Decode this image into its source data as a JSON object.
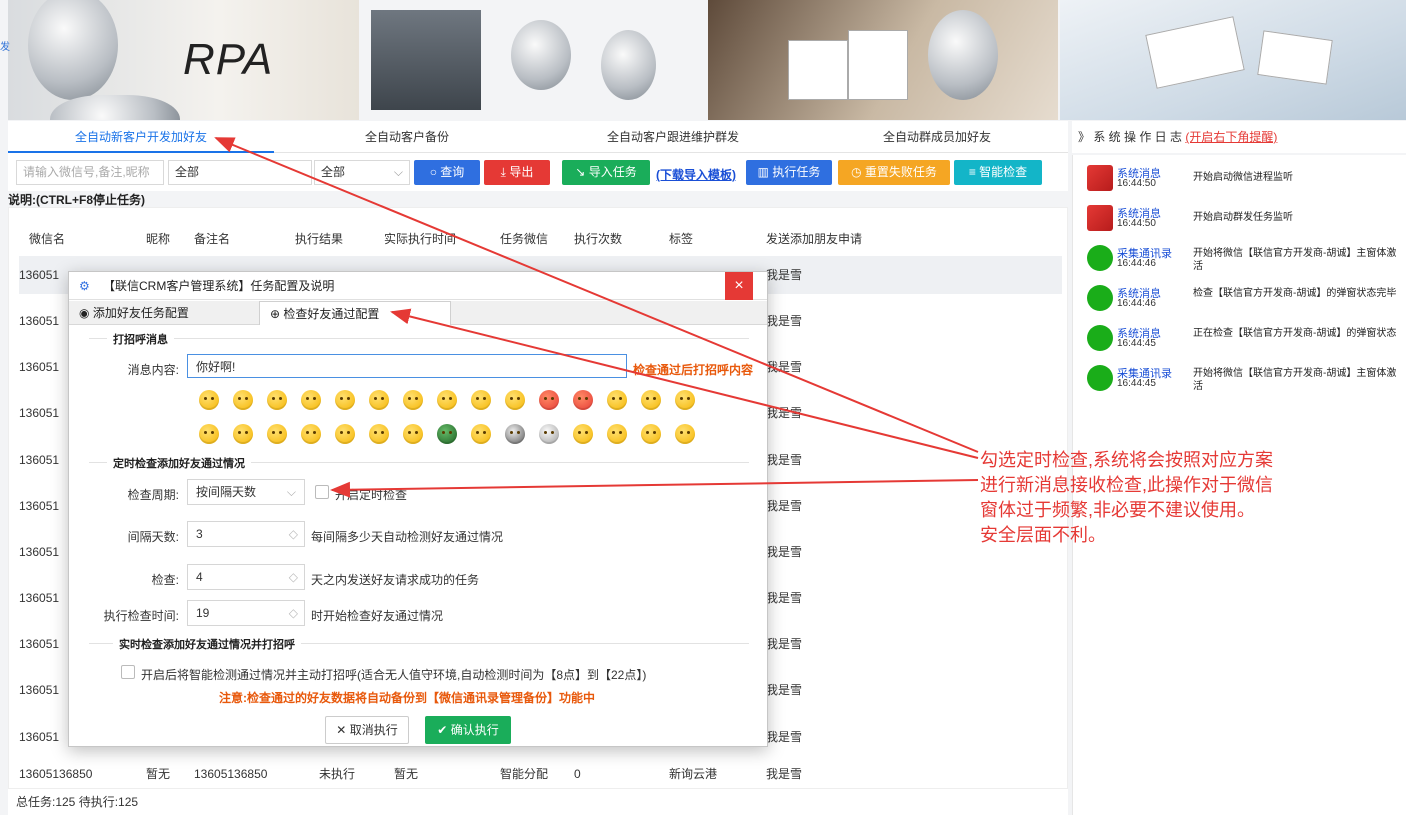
{
  "left_edge_char": "发",
  "banner": {
    "rpa_text": "RPA"
  },
  "tabs": [
    "全自动新客户开发加好友",
    "全自动客户备份",
    "全自动客户跟进维护群发",
    "全自动群成员加好友"
  ],
  "log_header": {
    "title": "》 系 统 操 作 日 志",
    "link": "(开启右下角提醒)"
  },
  "toolbar": {
    "search_placeholder": "请输入微信号,备注,昵称",
    "filter1": "全部",
    "filter2": "全部",
    "query": "查询",
    "export": "导出",
    "import_task": "导入任务",
    "download_template": "(下载导入模板)",
    "run_task": "执行任务",
    "reset_failed": "重置失败任务",
    "smart_check": "智能检查"
  },
  "note": "说明:(CTRL+F8停止任务)",
  "table": {
    "headers": [
      "微信名",
      "昵称",
      "备注名",
      "执行结果",
      "实际执行时间",
      "任务微信",
      "执行次数",
      "标签",
      "发送添加朋友申请"
    ],
    "row_prefix": "136051",
    "row_greeting": "我是雪",
    "last_row": [
      "13605136850",
      "暂无",
      "13605136850",
      "未执行",
      "暂无",
      "智能分配",
      "0",
      "新询云港",
      "我是雪"
    ]
  },
  "status": "总任务:125 待执行:125",
  "log": [
    {
      "name": "系统消息",
      "time": "16:44:50",
      "msg": "开始启动微信进程监听",
      "icon": "flag"
    },
    {
      "name": "系统消息",
      "time": "16:44:50",
      "msg": "开始启动群发任务监听",
      "icon": "flag"
    },
    {
      "name": "采集通讯录",
      "time": "16:44:46",
      "msg": "开始将微信【联信官方开发商-胡诚】主窗体激活",
      "icon": "wechat"
    },
    {
      "name": "系统消息",
      "time": "16:44:46",
      "msg": "检查【联信官方开发商-胡诚】的弹窗状态完毕",
      "icon": "wechat"
    },
    {
      "name": "系统消息",
      "time": "16:44:45",
      "msg": "正在检查【联信官方开发商-胡诚】的弹窗状态",
      "icon": "wechat"
    },
    {
      "name": "采集通讯录",
      "time": "16:44:45",
      "msg": "开始将微信【联信官方开发商-胡诚】主窗体激活",
      "icon": "wechat"
    }
  ],
  "dialog": {
    "title": "【联信CRM客户管理系统】任务配置及说明",
    "tab1": "添加好友任务配置",
    "tab2": "检查好友通过配置",
    "sec1": "打招呼消息",
    "msg_label": "消息内容:",
    "msg_value": "你好啊!",
    "msg_hint": "检查通过后打招呼内容",
    "sec2": "定时检查添加好友通过情况",
    "period_label": "检查周期:",
    "period_value": "按间隔天数",
    "timer_chk": "开启定时检查",
    "interval_label": "间隔天数:",
    "interval_value": "3",
    "interval_desc": "每间隔多少天自动检测好友通过情况",
    "check_label": "检查:",
    "check_value": "4",
    "check_desc": "天之内发送好友请求成功的任务",
    "time_label": "执行检查时间:",
    "time_value": "19",
    "time_desc": "时开始检查好友通过情况",
    "sec3": "实时检查添加好友通过情况并打招呼",
    "realtime_chk": "开启后将智能检测通过情况并主动打招呼(适合无人值守环境,自动检测时间为【8点】到【22点】)",
    "warning": "注意:检查通过的好友数据将自动备份到【微信通讯录管理备份】功能中",
    "cancel": "取消执行",
    "confirm": "确认执行"
  },
  "annotation": [
    "勾选定时检查,系统将会按照对应方案",
    "进行新消息接收检查,此操作对于微信",
    "窗体过于频繁,非必要不建议使用。",
    "安全层面不利。"
  ],
  "colors": {
    "accent": "#1a73e8",
    "red": "#e53935",
    "green": "#1aad5a",
    "orange": "#f5a623",
    "teal": "#13b5c8",
    "blue": "#2f6fe0"
  }
}
